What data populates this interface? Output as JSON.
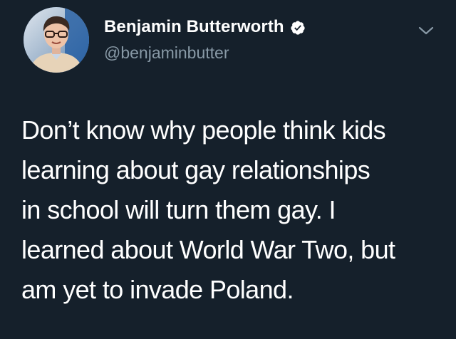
{
  "author": {
    "display_name": "Benjamin Butterworth",
    "handle": "@benjaminbutter",
    "verified": true,
    "avatar_icon": "profile-photo"
  },
  "tweet": {
    "lines": [
      "Don’t know why people think kids",
      "learning about gay relationships",
      "in school will turn them gay. I",
      "learned about World War Two, but",
      "am yet to invade Poland."
    ]
  },
  "icons": {
    "verified": "verified-badge-icon",
    "menu": "chevron-down-icon"
  },
  "colors": {
    "background": "#15202b",
    "text_primary": "#ffffff",
    "text_secondary": "#8899a6"
  }
}
